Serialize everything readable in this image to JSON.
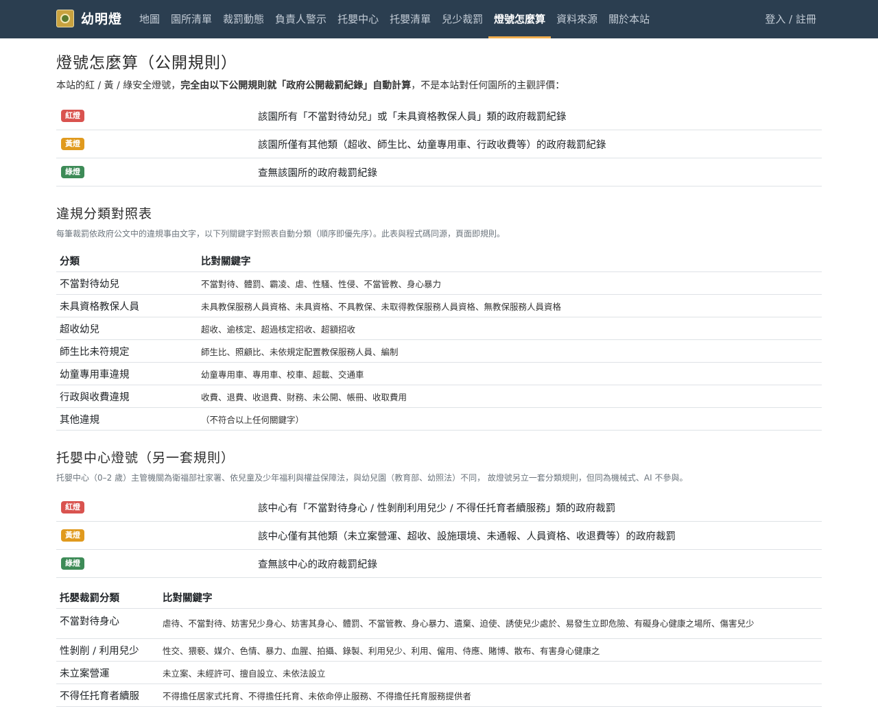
{
  "nav": {
    "brand": "幼明燈",
    "links": [
      "地圖",
      "園所清單",
      "裁罰動態",
      "負責人警示",
      "托嬰中心",
      "托嬰清單",
      "兒少裁罰",
      "燈號怎麼算",
      "資料來源",
      "關於本站"
    ],
    "active_index": 7,
    "login": "登入 / 註冊"
  },
  "section1": {
    "title": "燈號怎麼算（公開規則）",
    "intro_pre": "本站的紅 / 黃 / 綠安全燈號，",
    "intro_bold": "完全由以下公開規則就「政府公開裁罰紀錄」自動計算",
    "intro_post": "，不是本站對任何園所的主觀評價：",
    "rules": [
      {
        "badge": "紅燈",
        "text": "該園所有「不當對待幼兒」或「未具資格教保人員」類的政府裁罰紀錄"
      },
      {
        "badge": "黃燈",
        "text": "該園所僅有其他類（超收、師生比、幼童專用車、行政收費等）的政府裁罰紀錄"
      },
      {
        "badge": "綠燈",
        "text": "查無該園所的政府裁罰紀錄"
      }
    ]
  },
  "section2": {
    "title": "違規分類對照表",
    "desc": "每筆裁罰依政府公文中的違規事由文字，以下列關鍵字對照表自動分類（順序即優先序）。此表與程式碼同源，頁面即規則。",
    "headers": [
      "分類",
      "比對關鍵字"
    ],
    "rows": [
      {
        "category": "不當對待幼兒",
        "keywords": "不當對待、體罰、霸凌、虐、性騷、性侵、不當管教、身心暴力"
      },
      {
        "category": "未具資格教保人員",
        "keywords": "未具教保服務人員資格、未具資格、不具教保、未取得教保服務人員資格、無教保服務人員資格"
      },
      {
        "category": "超收幼兒",
        "keywords": "超收、逾核定、超過核定招收、超額招收"
      },
      {
        "category": "師生比未符規定",
        "keywords": "師生比、照顧比、未依規定配置教保服務人員、編制"
      },
      {
        "category": "幼童專用車違規",
        "keywords": "幼童專用車、專用車、校車、超載、交通車"
      },
      {
        "category": "行政與收費違規",
        "keywords": "收費、退費、收退費、財務、未公開、帳冊、收取費用"
      },
      {
        "category": "其他違規",
        "keywords": "（不符合以上任何關鍵字）"
      }
    ]
  },
  "section3": {
    "title": "托嬰中心燈號（另一套規則）",
    "desc": "托嬰中心（0–2 歲）主管機關為衛福部社家署、依兒童及少年福利與權益保障法，與幼兒園（教育部、幼照法）不同， 故燈號另立一套分類規則，但同為機械式、AI 不參與。",
    "rules": [
      {
        "badge": "紅燈",
        "text": "該中心有「不當對待身心 / 性剝削利用兒少 / 不得任托育者續服務」類的政府裁罰"
      },
      {
        "badge": "黃燈",
        "text": "該中心僅有其他類（未立案營運、超收、設施環境、未通報、人員資格、收退費等）的政府裁罰"
      },
      {
        "badge": "綠燈",
        "text": "查無該中心的政府裁罰紀錄"
      }
    ],
    "headers": [
      "托嬰裁罰分類",
      "比對關鍵字"
    ],
    "rows": [
      {
        "category": "不當對待身心",
        "keywords": "虐待、不當對待、妨害兒少身心、妨害其身心、體罰、不當管教、身心暴力、遺棄、迫使、誘使兒少處於、易發生立即危險、有礙身心健康之場所、傷害兒少"
      },
      {
        "category": "性剝削 / 利用兒少",
        "keywords": "性交、猥褻、媒介、色情、暴力、血腥、拍攝、錄製、利用兒少、利用、僱用、侍應、賭博、散布、有害身心健康之"
      },
      {
        "category": "未立案營運",
        "keywords": "未立案、未經許可、擅自設立、未依法設立"
      },
      {
        "category": "不得任托育者續服",
        "keywords": "不得擔任居家式托育、不得擔任托育、未依命停止服務、不得擔任托育服務提供者"
      }
    ]
  }
}
